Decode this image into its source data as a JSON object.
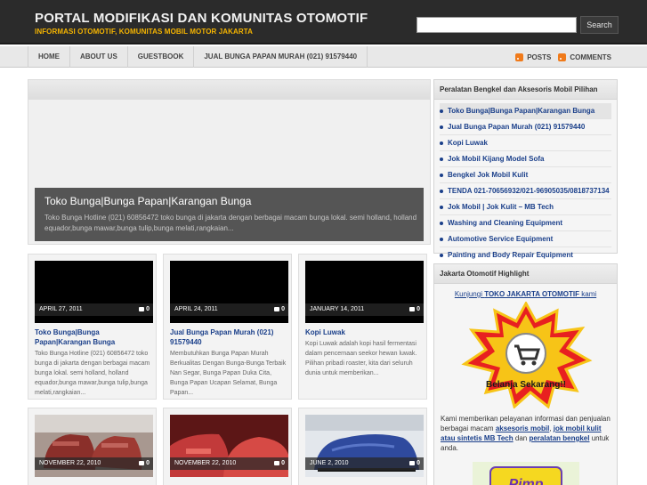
{
  "header": {
    "title": "PORTAL MODIFIKASI DAN KOMUNITAS OTOMOTIF",
    "description": "INFORMASI OTOMOTIF, KOMUNITAS MOBIL MOTOR JAKARTA",
    "search_placeholder": "",
    "search_button": "Search"
  },
  "nav": {
    "items": [
      "HOME",
      "ABOUT US",
      "GUESTBOOK",
      "JUAL BUNGA PAPAN MURAH (021) 91579440"
    ],
    "feeds": {
      "posts": "POSTS",
      "comments": "COMMENTS"
    }
  },
  "featured": {
    "title": "Toko Bunga|Bunga Papan|Karangan Bunga",
    "excerpt": "Toko Bunga Hotline (021) 60856472 toko bunga di jakarta dengan berbagai macam bunga lokal. semi holland, holland equador,bunga mawar,bunga tulip,bunga melati,rangkaian..."
  },
  "posts": [
    {
      "date": "APRIL 27, 2011",
      "comments": "0",
      "title": "Toko Bunga|Bunga Papan|Karangan Bunga",
      "excerpt": "Toko Bunga Hotline (021) 60856472 toko bunga di jakarta dengan berbagai macam bunga lokal. semi holland, holland equador,bunga mawar,bunga tulip,bunga melati,rangkaian..."
    },
    {
      "date": "APRIL 24, 2011",
      "comments": "0",
      "title": "Jual Bunga Papan Murah (021) 91579440",
      "excerpt": "Membutuhkan Bunga Papan Murah Berkualitas Dengan Bunga-Bunga Terbaik Nan Segar, Bunga Papan Duka Cita, Bunga Papan Ucapan Selamat, Bunga Papan..."
    },
    {
      "date": "JANUARY 14, 2011",
      "comments": "0",
      "title": "Kopi Luwak",
      "excerpt": "Kopi Luwak adalah kopi hasil fermentasi dalam pencernaan seekor hewan luwak. Pilihan pribadi roaster, kita dari seluruh dunia untuk memberikan..."
    },
    {
      "date": "NOVEMBER 22, 2010",
      "comments": "0"
    },
    {
      "date": "NOVEMBER 22, 2010",
      "comments": "0"
    },
    {
      "date": "JUNE 2, 2010",
      "comments": "0"
    }
  ],
  "sidebar": {
    "widget1": {
      "title": "Peralatan Bengkel dan Aksesoris Mobil Pilihan",
      "items": [
        "Toko Bunga|Bunga Papan|Karangan Bunga",
        "Jual Bunga Papan Murah (021) 91579440",
        "Kopi Luwak",
        "Jok Mobil Kijang Model Sofa",
        "Bengkel Jok Mobil Kulit",
        "TENDA 021-70656932/021-96905035/0818737134",
        "Jok Mobil | Jok Kulit – MB Tech",
        "Washing and Cleaning Equipment",
        "Automotive Service Equipment",
        "Painting and Body Repair Equipment"
      ]
    },
    "widget2": {
      "title": "Jakarta Otomotif Highlight",
      "link_prefix": "Kunjungi ",
      "link_bold": "TOKO JAKARTA OTOMOTIF",
      "link_suffix": " kami",
      "badge_text": "Belanja Sekarang!!",
      "text_1": "Kami memberikan pelayanan informasi dan penjualan berbagai macam ",
      "link_1": "aksesoris mobil",
      "text_2": ", ",
      "link_2": "jok mobil kulit atau sintetis MB Tech",
      "text_3": " dan ",
      "link_3": "peralatan bengkel",
      "text_4": " untuk anda.",
      "pimp_text": "Pimp"
    }
  }
}
